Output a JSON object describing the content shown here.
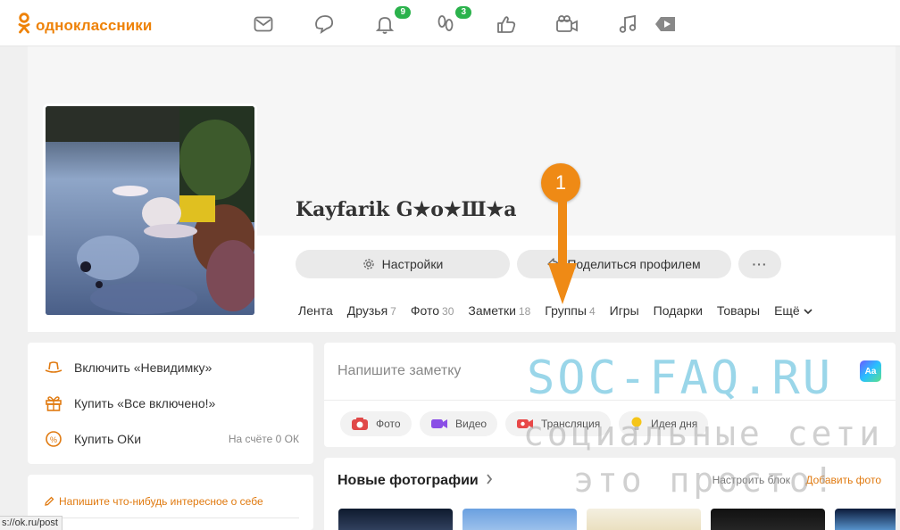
{
  "app": {
    "logo_text": "одноклассники",
    "brand_color": "#ee8208"
  },
  "topnav": {
    "icons": [
      {
        "name": "messages-icon"
      },
      {
        "name": "discussions-icon"
      },
      {
        "name": "notifications-icon",
        "badge": "9"
      },
      {
        "name": "guests-icon",
        "badge": "3"
      },
      {
        "name": "events-icon"
      },
      {
        "name": "video-calls-icon"
      },
      {
        "name": "music-icon"
      },
      {
        "name": "video-icon"
      }
    ]
  },
  "profile": {
    "name": "Kayfarik G★o★Ш★a",
    "settings_label": "Настройки",
    "share_label": "Поделиться профилем",
    "more_label": "···",
    "tabs": [
      {
        "label": "Лента",
        "count": ""
      },
      {
        "label": "Друзья",
        "count": "7"
      },
      {
        "label": "Фото",
        "count": "30"
      },
      {
        "label": "Заметки",
        "count": "18"
      },
      {
        "label": "Группы",
        "count": "4"
      },
      {
        "label": "Игры",
        "count": ""
      },
      {
        "label": "Подарки",
        "count": ""
      },
      {
        "label": "Товары",
        "count": ""
      },
      {
        "label": "Ещё",
        "count": ""
      }
    ]
  },
  "left_menu": {
    "invisible_label": "Включить «Невидимку»",
    "all_inclusive_label": "Купить «Все включено!»",
    "buy_ok_label": "Купить ОКи",
    "balance_label": "На счёте 0 ОК",
    "about_placeholder": "Напишите что-нибудь интересное о себе"
  },
  "composer": {
    "placeholder": "Напишите заметку",
    "aa_label": "Aa",
    "chips": [
      {
        "label": "Фото",
        "icon": "camera-icon"
      },
      {
        "label": "Видео",
        "icon": "video-camera-icon"
      },
      {
        "label": "Трансляция",
        "icon": "broadcast-icon"
      },
      {
        "label": "Идея дня",
        "icon": "lightbulb-icon"
      }
    ]
  },
  "new_photos": {
    "title": "Новые фотографии",
    "configure_label": "Настроить блок",
    "add_photo_label": "Добавить фото"
  },
  "watermark": {
    "line1": "SOC-FAQ.RU",
    "line2": "социальные сети",
    "line3": "это просто!"
  },
  "annotation": {
    "marker_number": "1"
  },
  "statusbar": {
    "url": "s://ok.ru/post"
  }
}
